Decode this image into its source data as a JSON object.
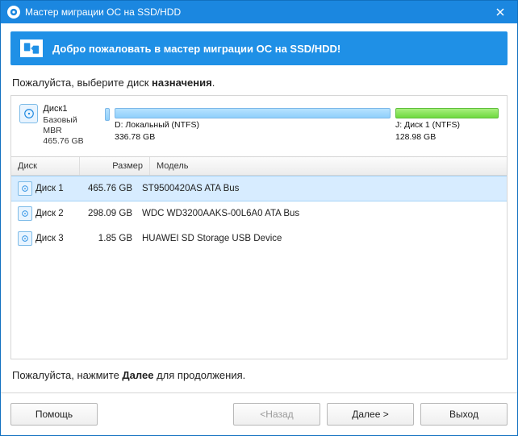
{
  "window": {
    "title": "Мастер миграции ОС на SSD/HDD"
  },
  "welcome": {
    "text": "Добро пожаловать в мастер миграции ОС на SSD/HDD!"
  },
  "instruction": {
    "pre": "Пожалуйста, выберите диск ",
    "bold": "назначения",
    "post": "."
  },
  "disk_summary": {
    "name": "Диск1",
    "type": "Базовый MBR",
    "capacity": "465.76 GB",
    "partitions": [
      {
        "label": "",
        "size": "",
        "class": "p0 blue"
      },
      {
        "label": "D: Локальный (NTFS)",
        "size": "336.78 GB",
        "class": "p1 blue"
      },
      {
        "label": "J: Диск 1 (NTFS)",
        "size": "128.98 GB",
        "class": "p2 green"
      }
    ]
  },
  "columns": {
    "disk": "Диск",
    "size": "Размер",
    "model": "Модель"
  },
  "rows": [
    {
      "name": "Диск 1",
      "size": "465.76 GB",
      "model": "ST9500420AS ATA Bus",
      "selected": true
    },
    {
      "name": "Диск 2",
      "size": "298.09 GB",
      "model": "WDC WD3200AAKS-00L6A0 ATA Bus",
      "selected": false
    },
    {
      "name": "Диск 3",
      "size": "1.85 GB",
      "model": "HUAWEI   SD Storage       USB Device",
      "selected": false
    }
  ],
  "instruction2": {
    "pre": "Пожалуйста, нажмите ",
    "bold": "Далее",
    "post": " для продолжения."
  },
  "buttons": {
    "help": "Помощь",
    "back": "<Назад",
    "next": "Далее >",
    "exit": "Выход"
  }
}
